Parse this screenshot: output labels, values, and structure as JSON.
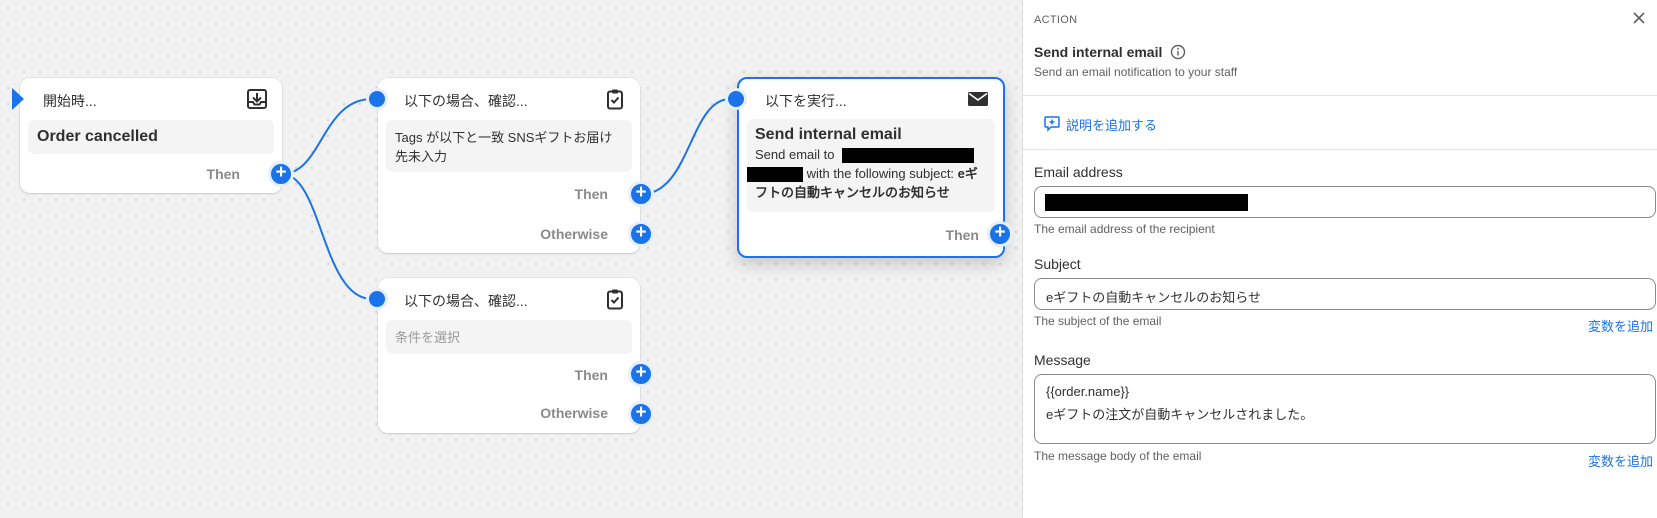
{
  "trigger": {
    "title": "開始時...",
    "event": "Order cancelled",
    "then_label": "Then"
  },
  "condition1": {
    "title": "以下の場合、確認...",
    "text": "Tags が以下と一致 SNSギフトお届け先未入力",
    "then_label": "Then",
    "otherwise_label": "Otherwise"
  },
  "condition2": {
    "title": "以下の場合、確認...",
    "placeholder": "条件を選択",
    "then_label": "Then",
    "otherwise_label": "Otherwise"
  },
  "action": {
    "title": "以下を実行...",
    "name": "Send internal email",
    "desc_prefix": "Send email to",
    "desc_middle": "with the following subject:",
    "subject": "eギフトの自動キャンセルのお知らせ",
    "then_label": "Then"
  },
  "panel": {
    "section_label": "ACTION",
    "title": "Send internal email",
    "subtitle": "Send an email notification to your staff",
    "add_description": "説明を追加する",
    "email_label": "Email address",
    "email_help": "The email address of the recipient",
    "subject_label": "Subject",
    "subject_value": "eギフトの自動キャンセルのお知らせ",
    "subject_help": "The subject of the email",
    "add_variable": "変数を追加",
    "message_label": "Message",
    "message_line1": "{{order.name}}",
    "message_line2": "eギフトの注文が自動キャンセルされました。",
    "message_help": "The message body of the email"
  },
  "colors": {
    "accent": "#1a73e8",
    "canvas_bg": "#f1f1f1"
  },
  "icons": {
    "trigger": "download-tray-icon",
    "condition": "clipboard-check-icon",
    "action": "envelope-icon",
    "info": "info-circle-icon",
    "close": "close-icon",
    "comment": "comment-add-icon",
    "plus": "plus-icon"
  }
}
